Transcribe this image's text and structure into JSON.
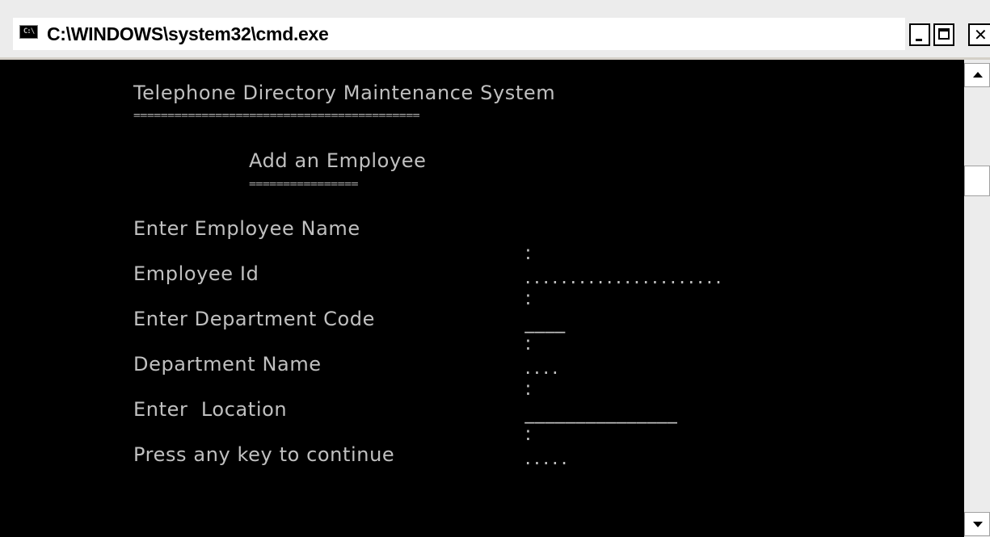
{
  "window": {
    "title": "C:\\WINDOWS\\system32\\cmd.exe",
    "icon": "cmd-console-icon",
    "icon_glyph": "C:\\",
    "controls": {
      "minimize": "minimize-icon",
      "maximize": "maximize-icon",
      "close": "close-icon",
      "close_glyph": "✕"
    }
  },
  "console": {
    "heading": "Telephone Directory Maintenance System",
    "heading_rule": "==========================================",
    "subheading": "Add an Employee",
    "subheading_rule": "================",
    "fields": [
      {
        "label": "Enter Employee Name",
        "colon": ":",
        "value": "......................"
      },
      {
        "label": "Employee Id",
        "colon": ":",
        "value": "____"
      },
      {
        "label": "Enter Department Code",
        "colon": ":",
        "value": "...."
      },
      {
        "label": "Department Name",
        "colon": ":",
        "value": "_______________"
      },
      {
        "label": "Enter  Location",
        "colon": ":",
        "value": "....."
      }
    ],
    "prompt": "Press any key to continue"
  },
  "scrollbar": {
    "position": 0.25
  },
  "colors": {
    "console_background": "#000000",
    "console_text": "#c0c0c0",
    "title_bar": "#ececec"
  }
}
